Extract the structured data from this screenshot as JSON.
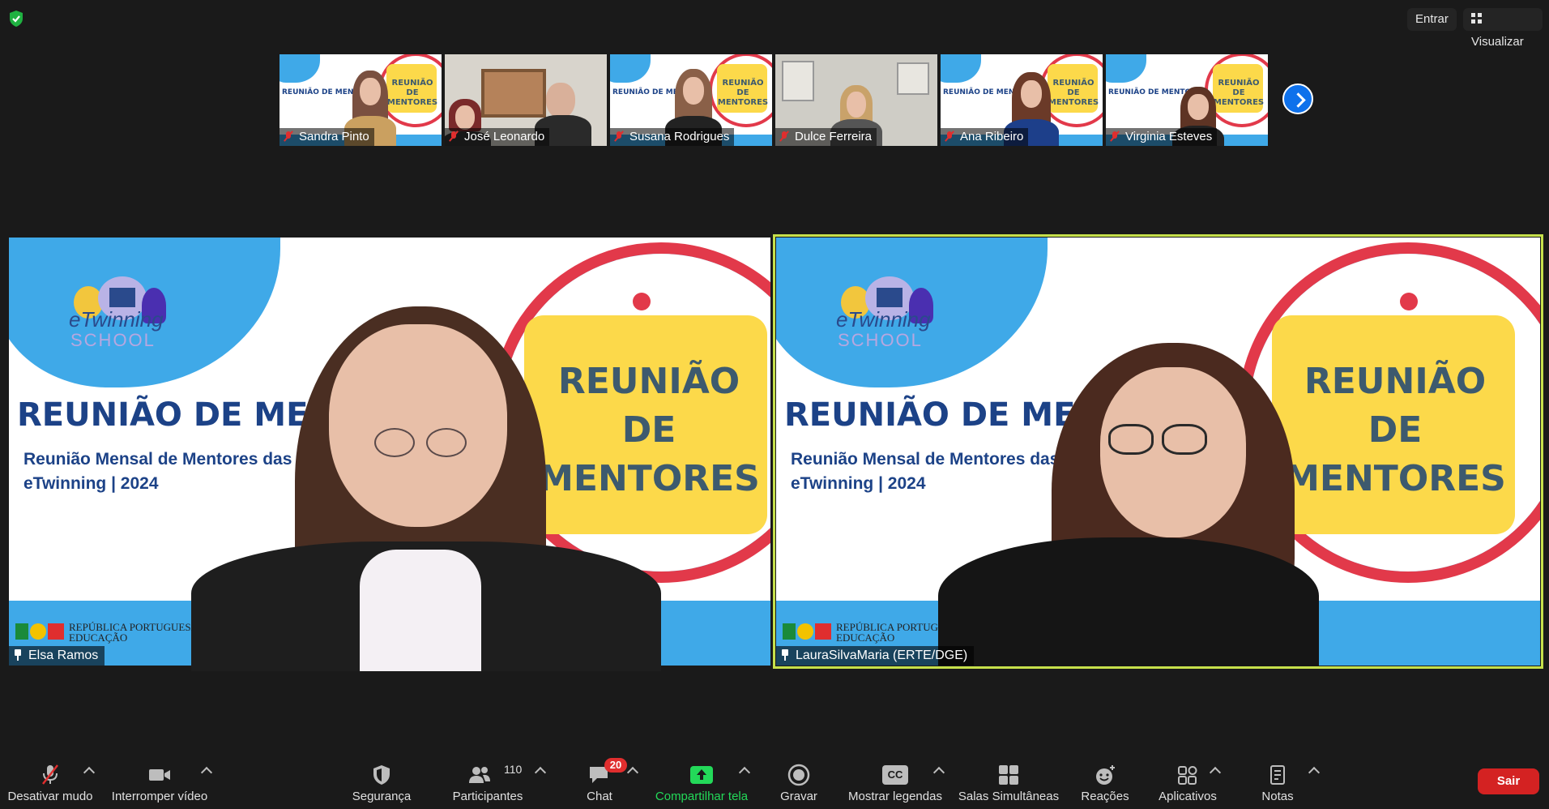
{
  "top_bar": {
    "security_status_icon": "shield-check-icon",
    "enter_label": "Entrar",
    "view_label": "Visualizar",
    "colors": {
      "shield": "#1fb141"
    }
  },
  "thumbnails": [
    {
      "name": "Sandra Pinto",
      "muted": true
    },
    {
      "name": "José Leonardo",
      "muted": true
    },
    {
      "name": "Susana Rodrigues",
      "muted": true
    },
    {
      "name": "Dulce Ferreira",
      "muted": true
    },
    {
      "name": "Ana Ribeiro",
      "muted": true
    },
    {
      "name": "Virginia Esteves",
      "muted": true
    }
  ],
  "slide": {
    "title": "REUNIÃO DE MENTORES",
    "subtitle_line1": "Reunião Mensal de Mentores das Escolas",
    "subtitle_line2": "eTwinning | 2024",
    "badge_line1": "REUNIÃO",
    "badge_line2": "DE",
    "badge_line3": "MENTORES",
    "logo_name": "eTwinning",
    "logo_sub": "SCHOOL",
    "republic_line1": "REPÚBLICA PORTUGUESA",
    "republic_line2": "EDUCAÇÃO",
    "colors": {
      "blue": "#3fa9e8",
      "yellow": "#fcd94a",
      "red": "#e2394a",
      "navy": "#1c4287"
    }
  },
  "main_tiles": [
    {
      "name": "Elsa Ramos",
      "pinned": true
    },
    {
      "name": "LauraSilvaMaria (ERTE/DGE)",
      "pinned": true,
      "active_speaker": true
    }
  ],
  "toolbar": {
    "mute": "Desativar mudo",
    "video": "Interromper vídeo",
    "security": "Segurança",
    "participants": "Participantes",
    "participants_count": "110",
    "chat": "Chat",
    "chat_badge": "20",
    "share": "Compartilhar tela",
    "record": "Gravar",
    "captions": "Mostrar legendas",
    "captions_icon_text": "CC",
    "breakout": "Salas Simultâneas",
    "reactions": "Reações",
    "apps": "Aplicativos",
    "notes": "Notas",
    "leave": "Sair",
    "colors": {
      "share": "#23d959",
      "leave": "#d42222",
      "badge": "#e02e2e",
      "active_border": "#c6e04b"
    }
  }
}
